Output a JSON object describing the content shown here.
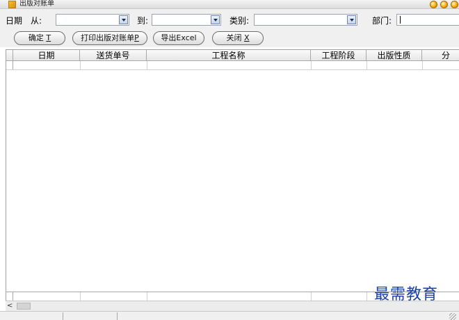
{
  "window": {
    "title": "出版对账单",
    "controls": [
      "minimize-icon",
      "maximize-icon",
      "close-icon"
    ]
  },
  "filters": {
    "date_label": "日期",
    "from_label": "从:",
    "from_value": "",
    "to_label": "到:",
    "to_value": "",
    "category_label": "类别:",
    "category_value": "",
    "department_label": "部门:",
    "department_value": ""
  },
  "buttons": {
    "confirm": {
      "label": "确定 ",
      "hotkey": "T"
    },
    "print": {
      "label": "打印出版对账单",
      "hotkey": "P"
    },
    "export": {
      "label": "导出Excel",
      "hotkey": ""
    },
    "close": {
      "label": "关闭 ",
      "hotkey": "X"
    }
  },
  "table": {
    "columns": [
      "日期",
      "送货单号",
      "工程名称",
      "工程阶段",
      "出版性质",
      "分"
    ]
  },
  "watermark": "最需教育",
  "colors": {
    "accent_button": "#f2a600",
    "watermark": "#1a3fa8"
  }
}
